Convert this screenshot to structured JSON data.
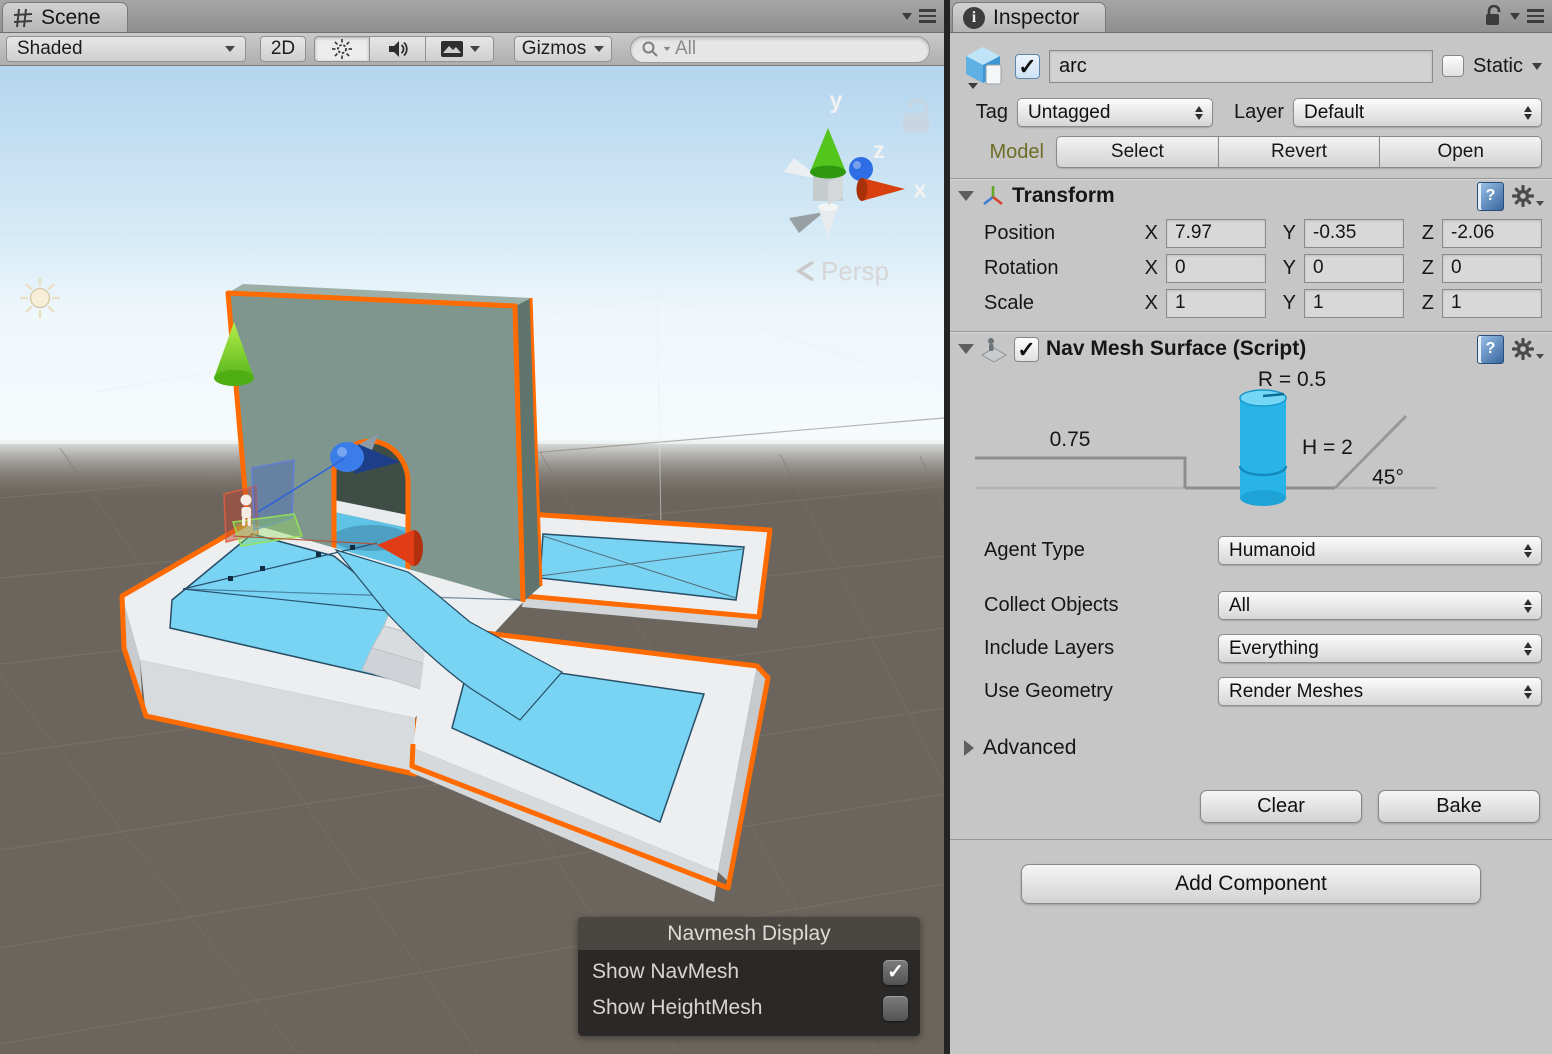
{
  "scene": {
    "tab": "Scene",
    "toolbar": {
      "shading_mode": "Shaded",
      "mode_2d": "2D",
      "gizmos": "Gizmos",
      "search_value": "All"
    },
    "viewport": {
      "persp": "Persp",
      "axis_x": "x",
      "axis_y": "y",
      "axis_z": "z"
    },
    "navmesh_overlay": {
      "title": "Navmesh Display",
      "rows": [
        {
          "label": "Show NavMesh",
          "checked": true
        },
        {
          "label": "Show HeightMesh",
          "checked": false
        }
      ]
    }
  },
  "inspector": {
    "tab": "Inspector",
    "game_object": {
      "name": "arc",
      "active": true,
      "static_label": "Static",
      "static_checked": false,
      "tag_label": "Tag",
      "tag_value": "Untagged",
      "layer_label": "Layer",
      "layer_value": "Default",
      "model_label": "Model",
      "model_buttons": [
        "Select",
        "Revert",
        "Open"
      ]
    },
    "transform": {
      "title": "Transform",
      "axis": [
        "X",
        "Y",
        "Z"
      ],
      "rows": [
        {
          "label": "Position",
          "values": [
            "7.97",
            "-0.35",
            "-2.06"
          ]
        },
        {
          "label": "Rotation",
          "values": [
            "0",
            "0",
            "0"
          ]
        },
        {
          "label": "Scale",
          "values": [
            "1",
            "1",
            "1"
          ]
        }
      ]
    },
    "nav_mesh_surface": {
      "title": "Nav Mesh Surface (Script)",
      "enabled": true,
      "diagram": {
        "radius": "R = 0.5",
        "step_height": "0.75",
        "height": "H = 2",
        "slope": "45°"
      },
      "fields": [
        {
          "label": "Agent Type",
          "value": "Humanoid"
        },
        {
          "label": "Collect Objects",
          "value": "All"
        },
        {
          "label": "Include Layers",
          "value": "Everything"
        },
        {
          "label": "Use Geometry",
          "value": "Render Meshes"
        }
      ],
      "advanced_label": "Advanced",
      "clear_label": "Clear",
      "bake_label": "Bake"
    },
    "add_component_label": "Add Component",
    "icons": {
      "help": "?"
    }
  },
  "colors": {
    "selection_orange": "#ff6b00",
    "navmesh_cyan": "#79d3f2",
    "agent_cylinder": "#29b4e8",
    "wall_teal": "#7e968e",
    "ground": "#6c655d"
  }
}
